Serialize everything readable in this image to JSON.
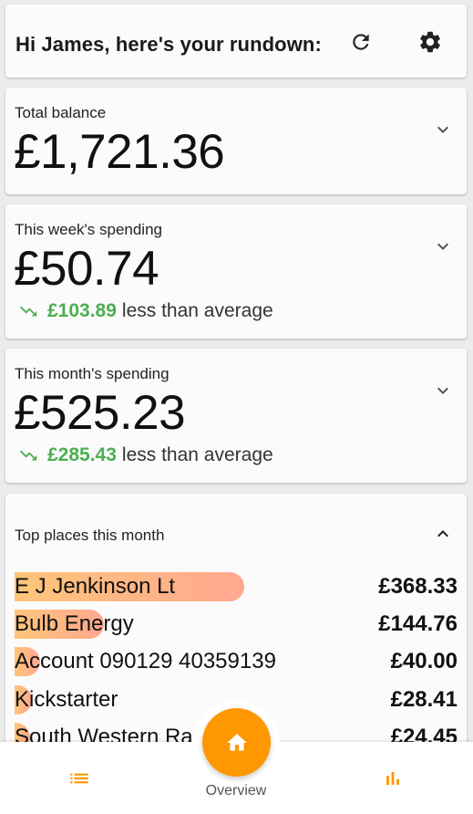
{
  "header": {
    "greeting": "Hi James, here's your rundown:",
    "refresh_icon": "refresh-icon",
    "settings_icon": "gear-icon"
  },
  "total_balance": {
    "label": "Total balance",
    "amount": "£1,721.36"
  },
  "week_spending": {
    "label": "This week's spending",
    "amount": "£50.74",
    "trend_value": "£103.89",
    "trend_text": "less than average",
    "trend_color": "#4caf50"
  },
  "month_spending": {
    "label": "This month's spending",
    "amount": "£525.23",
    "trend_value": "£285.43",
    "trend_text": "less than average",
    "trend_color": "#4caf50"
  },
  "top_places": {
    "title": "Top places this month",
    "items": [
      {
        "name": "E J Jenkinson Lt",
        "amount": "£368.33",
        "share": 1.0
      },
      {
        "name": "Bulb Energy",
        "amount": "£144.76",
        "share": 0.39
      },
      {
        "name": "Account 090129 40359139",
        "amount": "£40.00",
        "share": 0.11
      },
      {
        "name": "Kickstarter",
        "amount": "£28.41",
        "share": 0.077
      },
      {
        "name": "South Western Ra",
        "amount": "£24.45",
        "share": 0.066
      }
    ]
  },
  "bottom_nav": {
    "overview_label": "Overview",
    "accent": "#ff9800",
    "bar_gradient": [
      "#ffc57a",
      "#ffa890"
    ]
  }
}
